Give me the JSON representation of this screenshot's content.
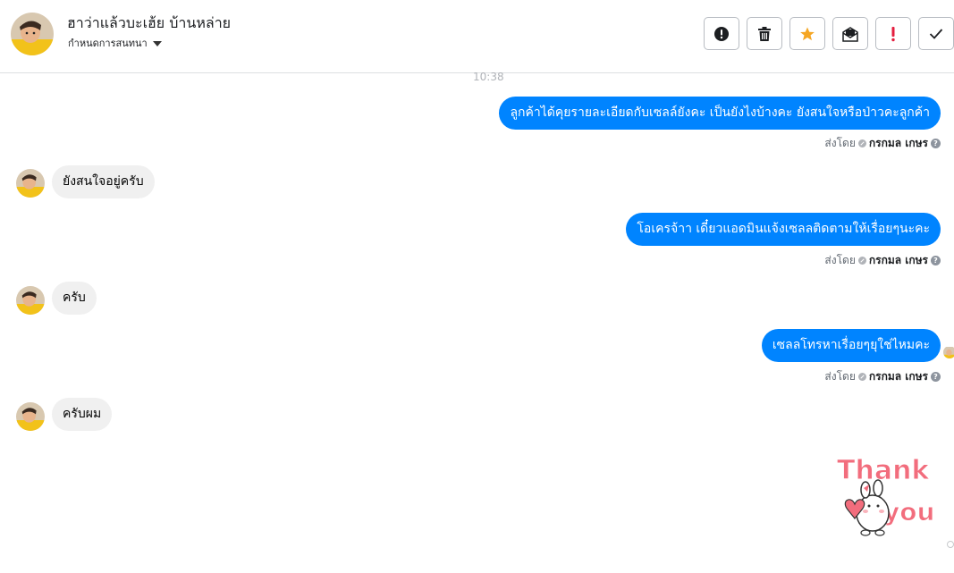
{
  "header": {
    "title": "ฮาว่าแล้วบะเฮ้ย บ้านหล่าย",
    "subtitle": "กำหนดการสนทนา"
  },
  "toolbar": {
    "buttons": [
      {
        "name": "info-button",
        "icon": "alert-circle-icon"
      },
      {
        "name": "delete-button",
        "icon": "trash-icon"
      },
      {
        "name": "star-button",
        "icon": "star-icon"
      },
      {
        "name": "mark-unread-button",
        "icon": "envelope-icon"
      },
      {
        "name": "important-button",
        "icon": "exclamation-icon"
      },
      {
        "name": "done-button",
        "icon": "check-icon"
      }
    ]
  },
  "conversation": {
    "timestamp": "10:38",
    "messages": [
      {
        "direction": "out",
        "text": "ลูกค้าได้คุยรายละเอียดกับเซลล์ยังคะ เป็นยังไงบ้างคะ ยังสนใจหรือป่าวคะลูกค้า",
        "sent_by_label": "ส่งโดย",
        "sender": "กรกมล เกษร"
      },
      {
        "direction": "in",
        "text": "ยังสนใจอยู่ครับ"
      },
      {
        "direction": "out",
        "text": "โอเครจ้าา เดี๋ยวแอดมินแจ้งเซลลติดตามให้เรื่อยๆนะคะ",
        "sent_by_label": "ส่งโดย",
        "sender": "กรกมล เกษร"
      },
      {
        "direction": "in",
        "text": "ครับ"
      },
      {
        "direction": "out",
        "text": "เซลลโทรหาเรื่อยๆยุใช่ไหมคะ",
        "sent_by_label": "ส่งโดย",
        "sender": "กรกมล เกษร"
      },
      {
        "direction": "in",
        "text": "ครับผม"
      }
    ],
    "sticker": {
      "line1": "Thank",
      "line2": "you"
    }
  },
  "colors": {
    "outgoing_bubble": "#0084ff",
    "incoming_bubble": "#f0f0f0",
    "star": "#f5a623",
    "important": "#e41e3f",
    "sticker_text": "#f26d7d"
  }
}
